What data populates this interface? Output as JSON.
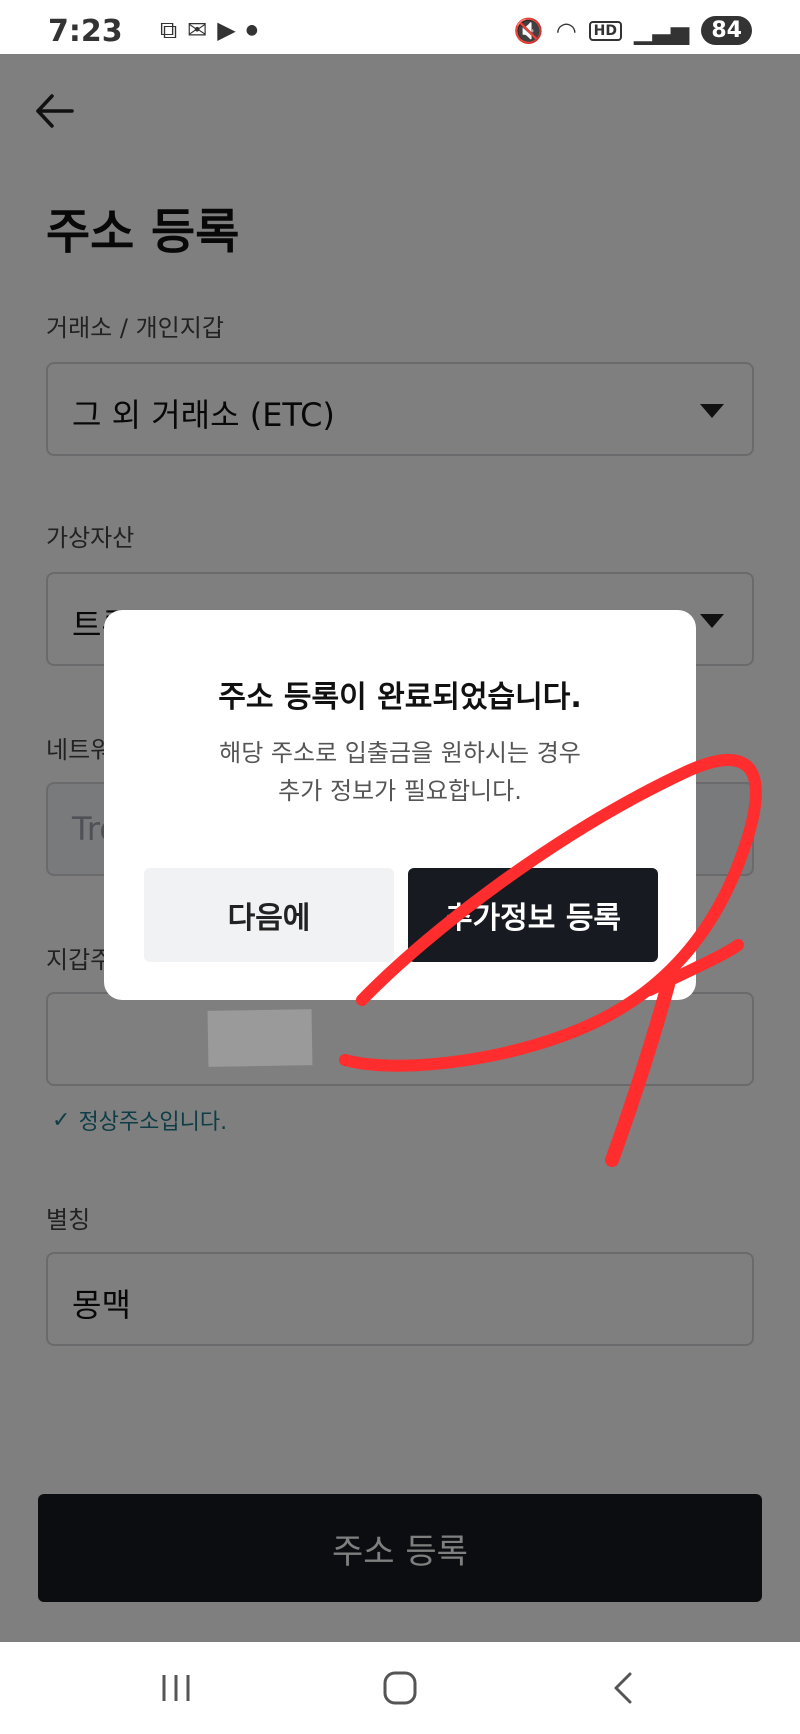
{
  "status_bar": {
    "time": "7:23",
    "battery": "84",
    "hd": "HD",
    "left_icons": [
      "screenshot-icon",
      "gmail-icon",
      "youtube-icon",
      "dot-icon"
    ],
    "right_icons": [
      "mute-icon",
      "wifi-icon",
      "hd-icon",
      "signal-icon",
      "battery-icon"
    ]
  },
  "header": {
    "title": "주소 등록"
  },
  "form": {
    "exchange": {
      "label": "거래소 / 개인지갑",
      "value": "그 외 거래소 (ETC)"
    },
    "asset": {
      "label": "가상자산",
      "value": "트론 (TRX)"
    },
    "network": {
      "label": "네트워크",
      "value": "Tron"
    },
    "wallet": {
      "label": "지갑주소",
      "value": "",
      "valid_msg": "정상주소입니다."
    },
    "alias": {
      "label": "별칭",
      "value": "몽맥"
    },
    "submit_label": "주소 등록"
  },
  "dialog": {
    "title": "주소 등록이 완료되었습니다.",
    "message_line1": "해당 주소로 입출금을 원하시는 경우",
    "message_line2": "추가 정보가 필요합니다.",
    "later_label": "다음에",
    "more_label": "추가정보 등록"
  },
  "colors": {
    "primary_button": "#171a20",
    "valid_text": "#1d7a8c",
    "annotation_red": "#ff2d2d"
  }
}
